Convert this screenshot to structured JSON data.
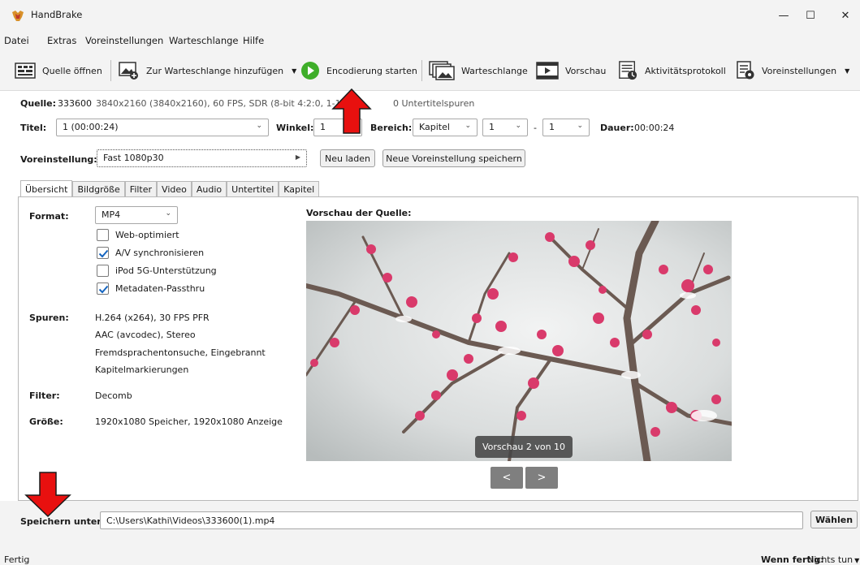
{
  "window": {
    "title": "HandBrake",
    "minimize": "—",
    "maximize": "☐",
    "close": "✕"
  },
  "menu": [
    "Datei",
    "Extras",
    "Voreinstellungen",
    "Warteschlange",
    "Hilfe"
  ],
  "toolbar": {
    "open_source": "Quelle öffnen",
    "add_queue": "Zur Warteschlange hinzufügen",
    "start_encode": "Encodierung starten",
    "queue": "Warteschlange",
    "preview": "Vorschau",
    "activity_log": "Aktivitätsprotokoll",
    "presets": "Voreinstellungen"
  },
  "source": {
    "label": "Quelle:",
    "name": "333600",
    "info_left": "3840x2160 (3840x2160), 60 FPS, SDR (8-bit 4:2:0, 1-1-1), 1",
    "info_right": "0 Untertitelspuren"
  },
  "title_row": {
    "title_label": "Titel:",
    "title_value": "1 (00:00:24)",
    "angle_label": "Winkel:",
    "angle_value": "1",
    "range_label": "Bereich:",
    "range_type": "Kapitel",
    "range_from": "1",
    "range_sep": "-",
    "range_to": "1",
    "duration_label": "Dauer:",
    "duration_value": "00:00:24"
  },
  "preset_row": {
    "label": "Voreinstellung:",
    "value": "Fast 1080p30",
    "reload": "Neu laden",
    "save_new": "Neue Voreinstellung speichern"
  },
  "tabs": [
    "Übersicht",
    "Bildgröße",
    "Filter",
    "Video",
    "Audio",
    "Untertitel",
    "Kapitel"
  ],
  "summary": {
    "format_label": "Format:",
    "format_value": "MP4",
    "checkboxes": [
      {
        "label": "Web-optimiert",
        "checked": false
      },
      {
        "label": "A/V synchronisieren",
        "checked": true
      },
      {
        "label": "iPod 5G-Unterstützung",
        "checked": false
      },
      {
        "label": "Metadaten-Passthru",
        "checked": true
      }
    ],
    "tracks_label": "Spuren:",
    "tracks": [
      "H.264 (x264), 30 FPS PFR",
      "AAC (avcodec), Stereo",
      "Fremdsprachentonsuche, Eingebrannt",
      "Kapitelmarkierungen"
    ],
    "filter_label": "Filter:",
    "filter_value": "Decomb",
    "size_label": "Größe:",
    "size_value": "1920x1080 Speicher, 1920x1080 Anzeige",
    "preview_title": "Vorschau der Quelle:",
    "preview_badge": "Vorschau 2 von 10",
    "prev": "<",
    "next": ">"
  },
  "save": {
    "label": "Speichern unter:",
    "path": "C:\\Users\\Kathi\\Videos\\333600(1).mp4",
    "browse": "Wählen"
  },
  "status": {
    "left": "Fertig",
    "when_done_label": "Wenn fertig:",
    "when_done_value": "Nichts tun"
  },
  "colors": {
    "arrow": "#e8100f",
    "play_green": "#3fae2a"
  },
  "icons": [
    "handbrake-icon",
    "open-source-icon",
    "add-queue-icon",
    "play-icon",
    "queue-icon",
    "preview-icon",
    "activity-log-icon",
    "presets-icon"
  ]
}
